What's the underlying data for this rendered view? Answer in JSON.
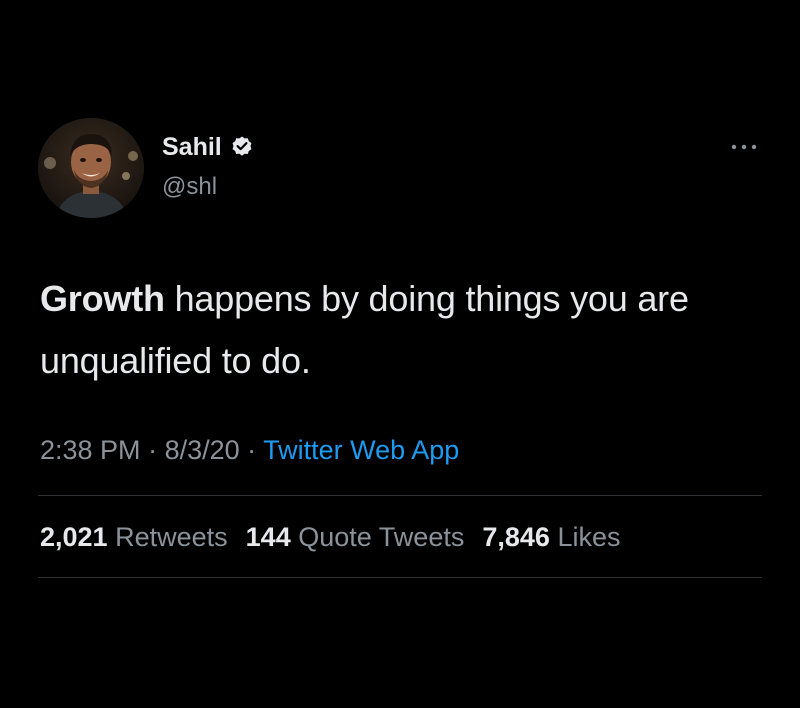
{
  "author": {
    "display_name": "Sahil",
    "handle": "@shl",
    "verified": true,
    "avatar_icon": "profile-photo"
  },
  "tweet": {
    "text_bold": "Growth",
    "text_rest": " happens by doing things you are unqualified to do."
  },
  "meta": {
    "time": "2:38 PM",
    "separator": " · ",
    "date": "8/3/20",
    "source": "Twitter Web App"
  },
  "stats": {
    "retweets_count": "2,021",
    "retweets_label": "Retweets",
    "quotes_count": "144",
    "quotes_label": "Quote Tweets",
    "likes_count": "7,846",
    "likes_label": "Likes"
  },
  "colors": {
    "background": "#000000",
    "primary_text": "#e7e9ea",
    "secondary_text": "#8b9299",
    "link": "#1d9bf0",
    "divider": "#2f3336"
  },
  "icons": {
    "verified": "verified-badge-icon",
    "more": "more-options-icon"
  }
}
